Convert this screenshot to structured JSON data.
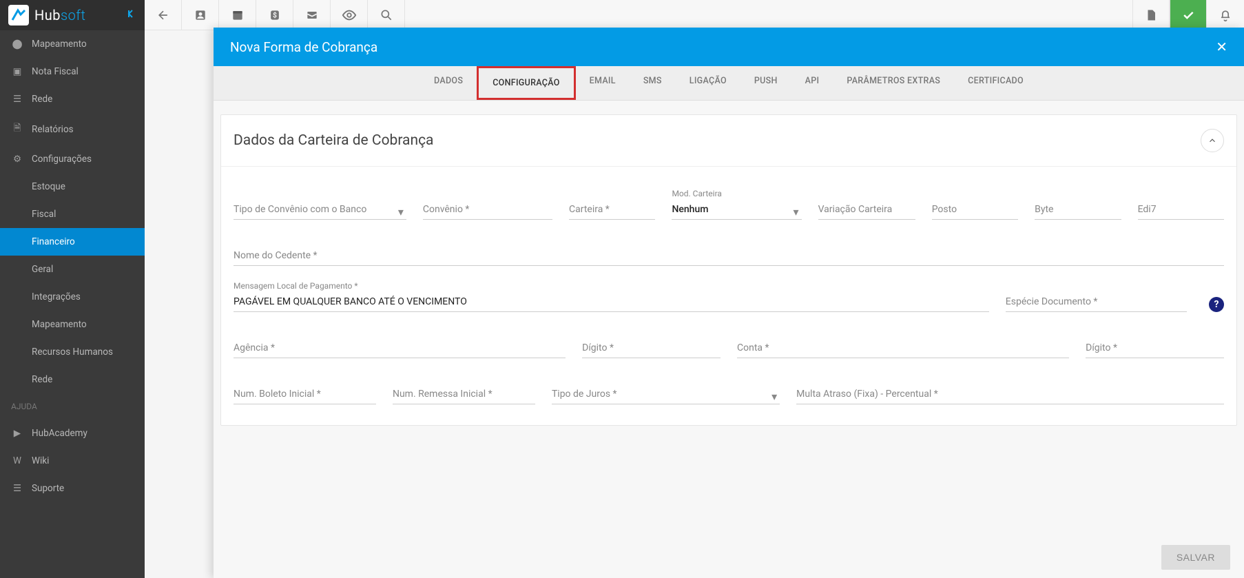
{
  "brand": {
    "logo_prefix": "Hub",
    "logo_suffix": "soft"
  },
  "sidebar": {
    "items": [
      {
        "icon": "location-dot",
        "label": "Mapeamento"
      },
      {
        "icon": "file",
        "label": "Nota Fiscal"
      },
      {
        "icon": "bars",
        "label": "Rede"
      },
      {
        "icon": "file-lines",
        "label": "Relatórios"
      },
      {
        "icon": "gear",
        "label": "Configurações"
      },
      {
        "icon": "",
        "label": "Estoque"
      },
      {
        "icon": "",
        "label": "Fiscal"
      },
      {
        "icon": "",
        "label": "Financeiro",
        "active": true
      },
      {
        "icon": "",
        "label": "Geral"
      },
      {
        "icon": "",
        "label": "Integrações"
      },
      {
        "icon": "",
        "label": "Mapeamento"
      },
      {
        "icon": "",
        "label": "Recursos Humanos"
      },
      {
        "icon": "",
        "label": "Rede"
      }
    ],
    "help_label": "AJUDA",
    "help_items": [
      {
        "icon": "play",
        "label": "HubAcademy"
      },
      {
        "icon": "w",
        "label": "Wiki"
      },
      {
        "icon": "support",
        "label": "Suporte"
      }
    ]
  },
  "modal": {
    "title": "Nova Forma de Cobrança",
    "tabs": [
      "DADOS",
      "CONFIGURAÇÃO",
      "EMAIL",
      "SMS",
      "LIGAÇÃO",
      "PUSH",
      "API",
      "PARÂMETROS EXTRAS",
      "CERTIFICADO"
    ],
    "active_tab": "CONFIGURAÇÃO",
    "panel_title": "Dados da Carteira de Cobrança",
    "fields": {
      "tipo_convenio": "Tipo de Convênio com o Banco",
      "convenio": "Convênio *",
      "carteira": "Carteira *",
      "mod_carteira_label": "Mod. Carteira",
      "mod_carteira_value": "Nenhum",
      "variacao": "Variação Carteira",
      "posto": "Posto",
      "byte": "Byte",
      "edi7": "Edi7",
      "nome_cedente": "Nome do Cedente *",
      "msg_local_label": "Mensagem Local de Pagamento *",
      "msg_local_value": "PAGÁVEL EM QUALQUER BANCO ATÉ O VENCIMENTO",
      "especie_doc": "Espécie Documento *",
      "agencia": "Agência *",
      "digito1": "Dígito *",
      "conta": "Conta *",
      "digito2": "Dígito *",
      "num_boleto": "Num. Boleto Inicial *",
      "num_remessa": "Num. Remessa Inicial *",
      "tipo_juros": "Tipo de Juros *",
      "multa_atraso": "Multa Atraso (Fixa) - Percentual *"
    },
    "save_label": "SALVAR"
  }
}
